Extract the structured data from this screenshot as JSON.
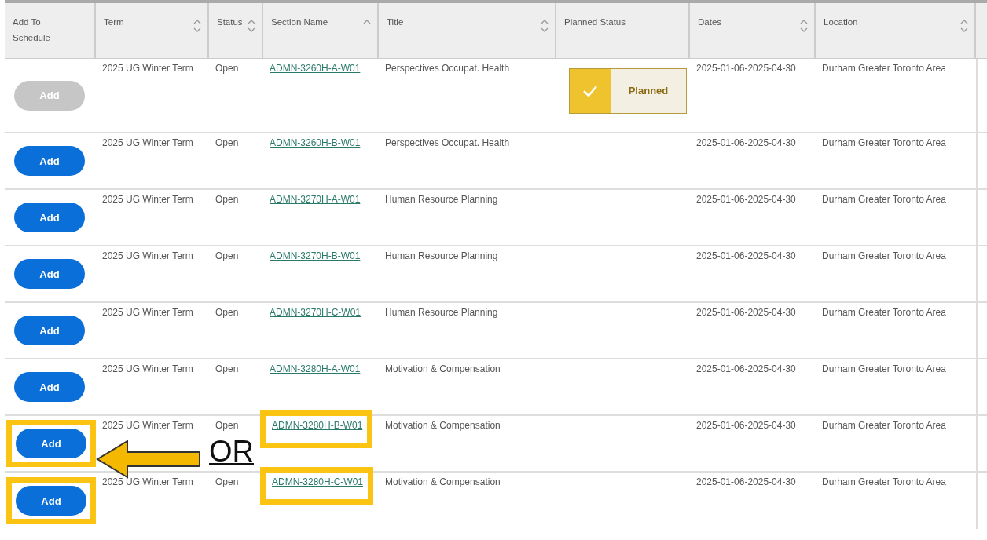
{
  "columns": [
    {
      "label": "Add To Schedule",
      "sort_up": false,
      "sort_down": false
    },
    {
      "label": "Term",
      "sort_up": true,
      "sort_down": true
    },
    {
      "label": "Status",
      "sort_up": true,
      "sort_down": true
    },
    {
      "label": "Section Name",
      "sort_up": true,
      "sort_down": false
    },
    {
      "label": "Title",
      "sort_up": true,
      "sort_down": true
    },
    {
      "label": "Planned Status",
      "sort_up": false,
      "sort_down": false
    },
    {
      "label": "Dates",
      "sort_up": true,
      "sort_down": true
    },
    {
      "label": "Location",
      "sort_up": true,
      "sort_down": true
    }
  ],
  "rows": [
    {
      "add": {
        "label": "Add",
        "disabled": true
      },
      "term": "2025 UG Winter Term",
      "status": "Open",
      "section": "ADMN-3260H-A-W01",
      "title": "Perspectives Occupat. Health",
      "planned": "Planned",
      "dates": "2025-01-06-2025-04-30",
      "location": "Durham Greater Toronto Area",
      "highlighted": false
    },
    {
      "add": {
        "label": "Add",
        "disabled": false
      },
      "term": "2025 UG Winter Term",
      "status": "Open",
      "section": "ADMN-3260H-B-W01",
      "title": "Perspectives Occupat. Health",
      "dates": "2025-01-06-2025-04-30",
      "location": "Durham Greater Toronto Area",
      "highlighted": false
    },
    {
      "add": {
        "label": "Add",
        "disabled": false
      },
      "term": "2025 UG Winter Term",
      "status": "Open",
      "section": "ADMN-3270H-A-W01",
      "title": "Human Resource Planning",
      "dates": "2025-01-06-2025-04-30",
      "location": "Durham Greater Toronto Area",
      "highlighted": false
    },
    {
      "add": {
        "label": "Add",
        "disabled": false
      },
      "term": "2025 UG Winter Term",
      "status": "Open",
      "section": "ADMN-3270H-B-W01",
      "title": "Human Resource Planning",
      "dates": "2025-01-06-2025-04-30",
      "location": "Durham Greater Toronto Area",
      "highlighted": false
    },
    {
      "add": {
        "label": "Add",
        "disabled": false
      },
      "term": "2025 UG Winter Term",
      "status": "Open",
      "section": "ADMN-3270H-C-W01",
      "title": "Human Resource Planning",
      "dates": "2025-01-06-2025-04-30",
      "location": "Durham Greater Toronto Area",
      "highlighted": false
    },
    {
      "add": {
        "label": "Add",
        "disabled": false
      },
      "term": "2025 UG Winter Term",
      "status": "Open",
      "section": "ADMN-3280H-A-W01",
      "title": "Motivation & Compensation",
      "dates": "2025-01-06-2025-04-30",
      "location": "Durham Greater Toronto Area",
      "highlighted": false
    },
    {
      "add": {
        "label": "Add",
        "disabled": false
      },
      "term": "2025 UG Winter Term",
      "status": "Open",
      "section": "ADMN-3280H-B-W01",
      "title": "Motivation & Compensation",
      "dates": "2025-01-06-2025-04-30",
      "location": "Durham Greater Toronto Area",
      "highlighted": true,
      "annotation": "OR"
    },
    {
      "add": {
        "label": "Add",
        "disabled": false
      },
      "term": "2025 UG Winter Term",
      "status": "Open",
      "section": "ADMN-3280H-C-W01",
      "title": "Motivation & Compensation",
      "dates": "2025-01-06-2025-04-30",
      "location": "Durham Greater Toronto Area",
      "highlighted": true
    }
  ]
}
